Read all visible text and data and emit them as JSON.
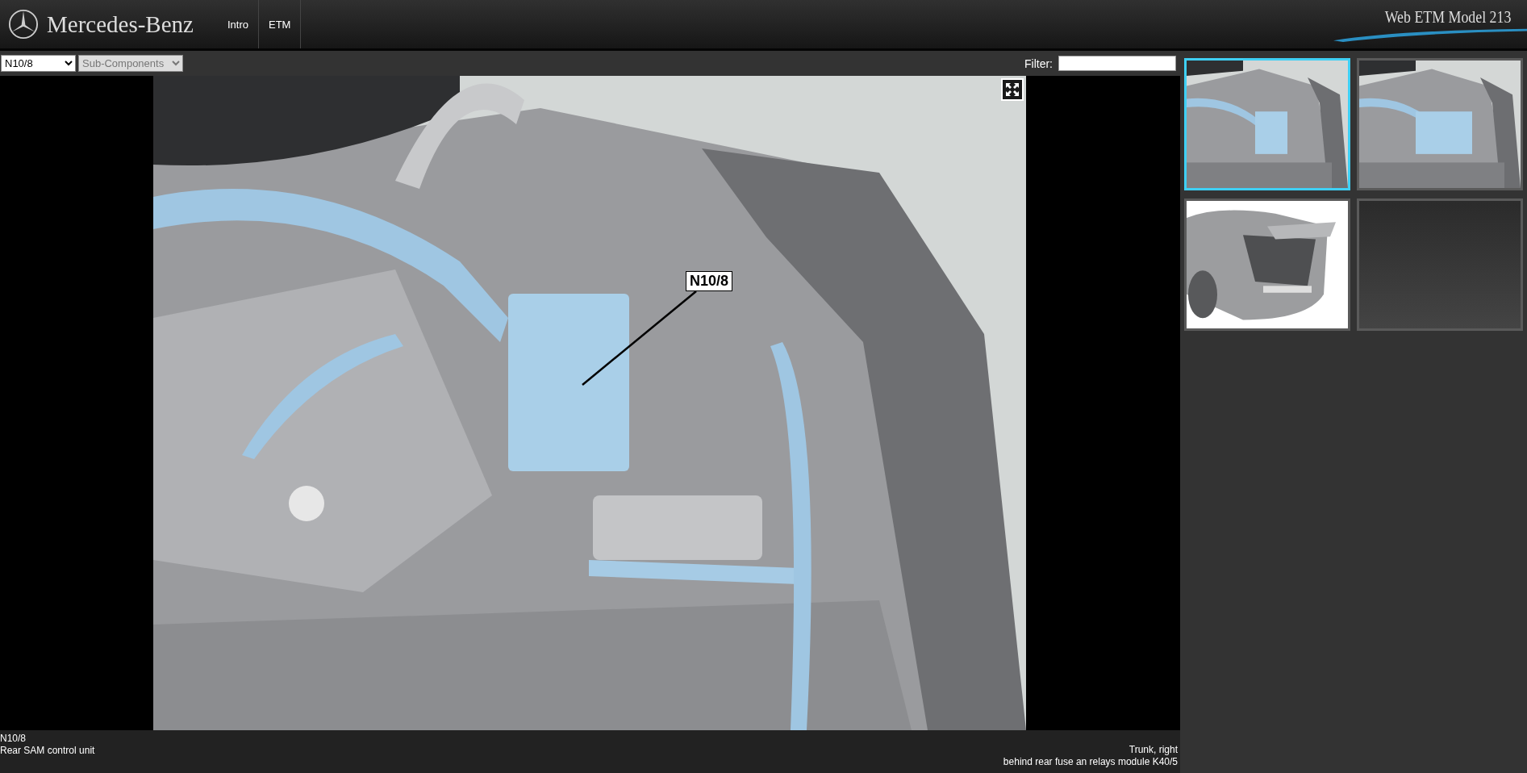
{
  "header": {
    "brand": "Mercedes-Benz",
    "nav": [
      "Intro",
      "ETM"
    ],
    "app_title": "Web ETM Model 213"
  },
  "toolbar": {
    "component_select": {
      "value": "N10/8",
      "disabled": false
    },
    "subcomponent_select": {
      "value": "Sub-Components",
      "disabled": true
    },
    "filter": {
      "label": "Filter:"
    }
  },
  "viewer": {
    "callout": "N10/8"
  },
  "info": {
    "code": "N10/8",
    "name": "Rear SAM control unit",
    "location": "Trunk, right",
    "detail": "behind rear fuse an relays module K40/5"
  },
  "thumbnails": [
    {
      "kind": "picture",
      "selected": true
    },
    {
      "kind": "picture",
      "selected": false
    },
    {
      "kind": "picture",
      "selected": false
    },
    {
      "kind": "empty",
      "selected": false
    }
  ]
}
